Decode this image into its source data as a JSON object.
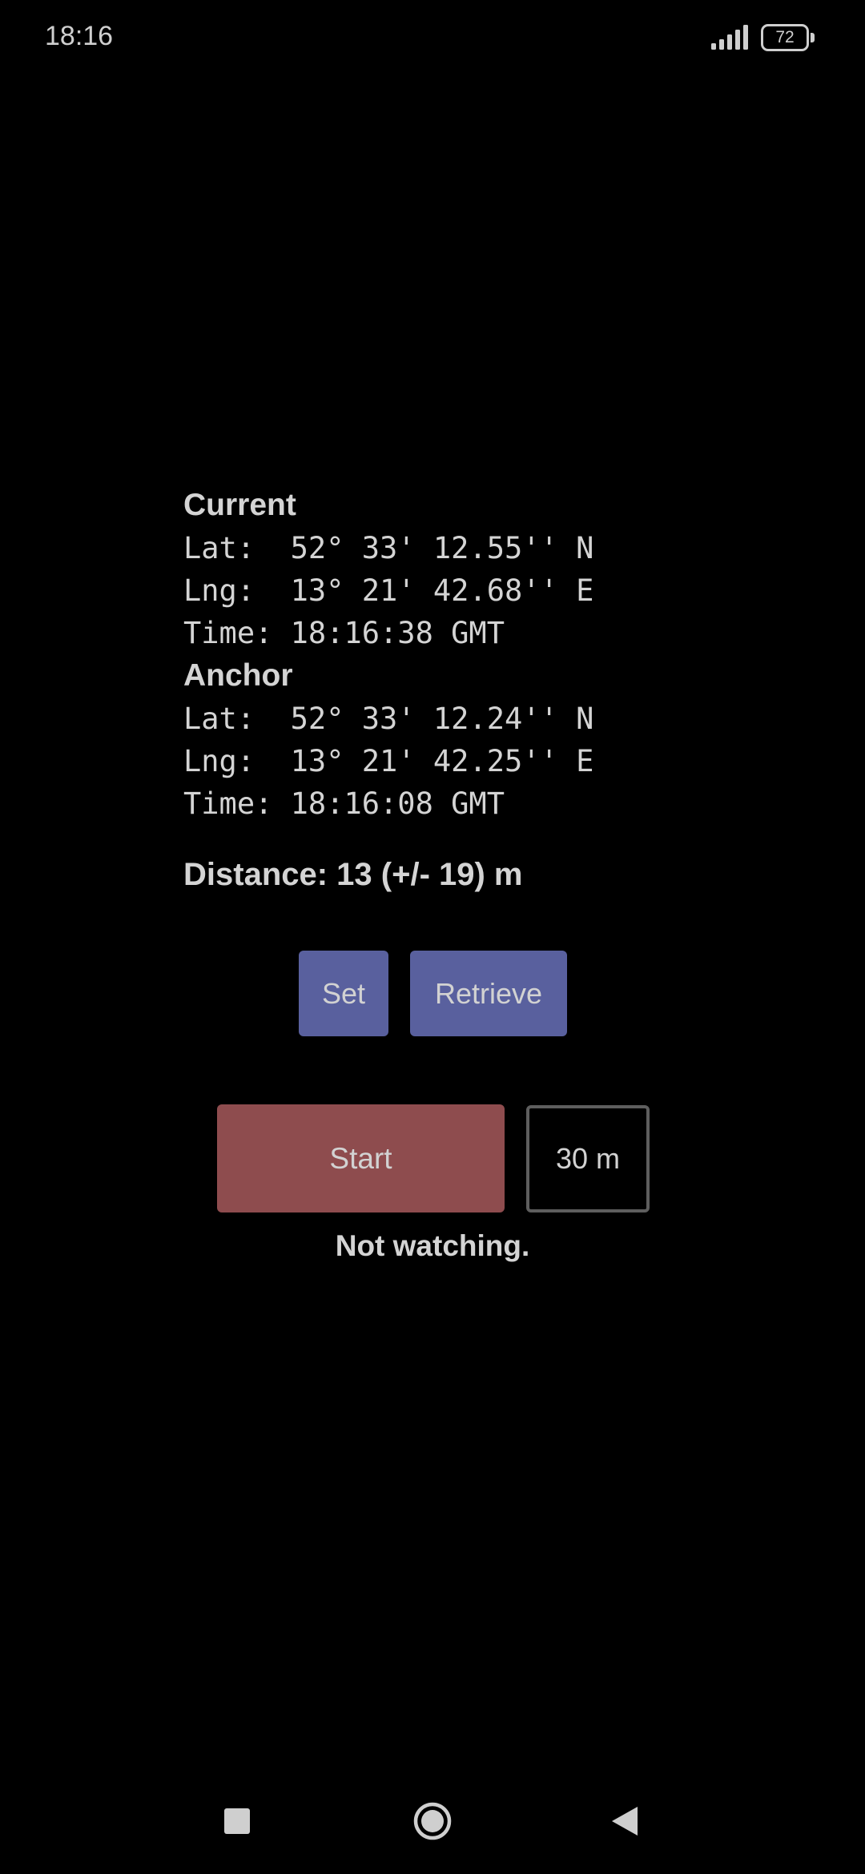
{
  "status_bar": {
    "time": "18:16",
    "battery_level": "72",
    "signal_icon": "signal-bars-icon",
    "battery_icon": "battery-icon"
  },
  "current": {
    "heading": "Current",
    "lat": "Lat:  52° 33' 12.55'' N",
    "lng": "Lng:  13° 21' 42.68'' E",
    "time": "Time: 18:16:38 GMT"
  },
  "anchor": {
    "heading": "Anchor",
    "lat": "Lat:  52° 33' 12.24'' N",
    "lng": "Lng:  13° 21' 42.25'' E",
    "time": "Time: 18:16:08 GMT"
  },
  "distance": "Distance: 13 (+/- 19) m",
  "buttons": {
    "set_label": "Set",
    "retrieve_label": "Retrieve",
    "start_label": "Start"
  },
  "radius_value": "30 m",
  "watch_status": "Not watching.",
  "colors": {
    "background": "#000000",
    "text": "#d4d4d4",
    "anchor_buttons": "#59609e",
    "start_button": "#8e4c4e",
    "radius_border": "#5e5e5e"
  },
  "nav_bar": {
    "recents_icon": "square-recents-icon",
    "home_icon": "circle-home-icon",
    "back_icon": "triangle-back-icon"
  }
}
